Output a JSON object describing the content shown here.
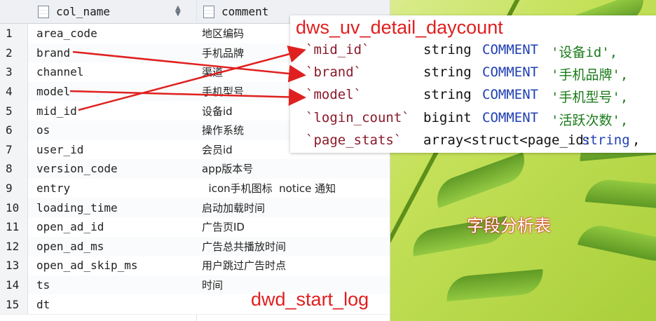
{
  "table": {
    "headers": [
      "col_name",
      "comment"
    ],
    "rows": [
      {
        "n": "1",
        "col": "area_code",
        "comment": "地区编码"
      },
      {
        "n": "2",
        "col": "brand",
        "comment": "手机品牌"
      },
      {
        "n": "3",
        "col": "channel",
        "comment": "渠道"
      },
      {
        "n": "4",
        "col": "model",
        "comment": "手机型号"
      },
      {
        "n": "5",
        "col": "mid_id",
        "comment": "设备id"
      },
      {
        "n": "6",
        "col": "os",
        "comment": "操作系统"
      },
      {
        "n": "7",
        "col": "user_id",
        "comment": "会员id"
      },
      {
        "n": "8",
        "col": "version_code",
        "comment": "app版本号"
      },
      {
        "n": "9",
        "col": "entry",
        "comment": "  icon手机图标  notice 通知  "
      },
      {
        "n": "10",
        "col": "loading_time",
        "comment": "启动加载时间"
      },
      {
        "n": "11",
        "col": "open_ad_id",
        "comment": "广告页ID"
      },
      {
        "n": "12",
        "col": "open_ad_ms",
        "comment": "广告总共播放时间"
      },
      {
        "n": "13",
        "col": "open_ad_skip_ms",
        "comment": "用户跳过广告时点"
      },
      {
        "n": "14",
        "col": "ts",
        "comment": "时间"
      },
      {
        "n": "15",
        "col": "dt",
        "comment": ""
      }
    ]
  },
  "code_box": {
    "title": "dws_uv_detail_daycount",
    "lines": [
      {
        "field": "`mid_id`",
        "type": "string",
        "kw": "COMMENT",
        "str": "'设备id',"
      },
      {
        "field": "`brand`",
        "type": "string",
        "kw": "COMMENT",
        "str": "'手机品牌',"
      },
      {
        "field": "`model`",
        "type": "string",
        "kw": "COMMENT",
        "str": "'手机型号',"
      },
      {
        "field": "`login_count`",
        "type": "bigint",
        "kw": "COMMENT",
        "str": "'活跃次数',"
      },
      {
        "field": "`page_stats`",
        "type": "array<struct<page_id:",
        "kw": "string",
        "str": ","
      }
    ]
  },
  "labels": {
    "analysis": "字段分析表",
    "source_table": "dwd_start_log"
  },
  "colors": {
    "annotation": "#e02020",
    "keyword": "#1f3fb5",
    "field": "#8a1a2a",
    "string": "#1b7a1b"
  }
}
